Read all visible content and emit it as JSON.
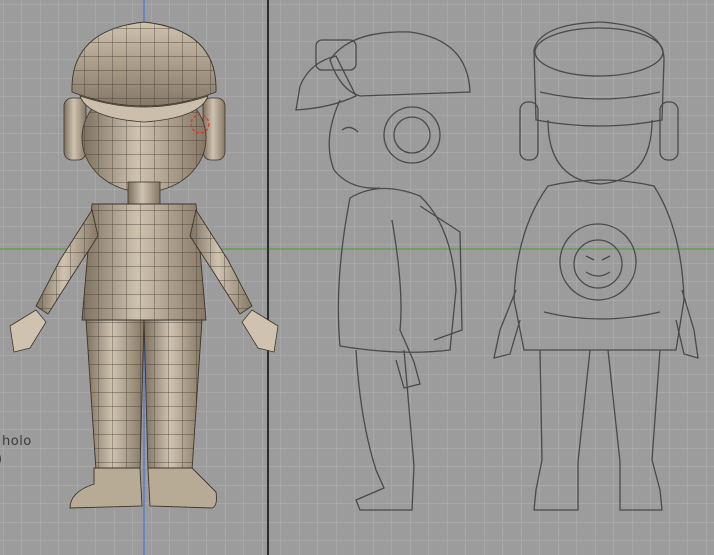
{
  "viewport": {
    "background": "#9c9c9c",
    "grid_color": "#b4b4b4",
    "axis_y_color": "#4a74d0",
    "axis_x_color": "#5a9a4a",
    "divider_color": "#2c2c2c",
    "model_color": "#a89a86",
    "sketch_color": "#4a4a4a"
  },
  "object_label": "holo",
  "object_label_fragment": ")"
}
